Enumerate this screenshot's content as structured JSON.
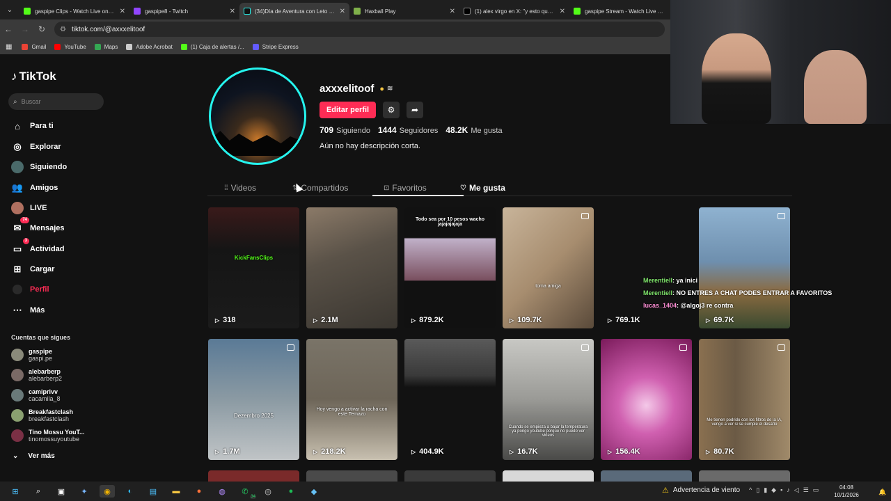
{
  "browser": {
    "tabs": [
      {
        "title": "gaspipe Clips - Watch Live on Kick",
        "color": "#53fc18",
        "active": false
      },
      {
        "title": "gaspipe8 - Twitch",
        "color": "#9146ff",
        "active": false
      },
      {
        "title": "(34)Día de Aventura con Leto e...",
        "color": "#ffffff",
        "active": true
      },
      {
        "title": "Haxball Play",
        "color": "#7fb04a",
        "active": false
      },
      {
        "title": "(1) alex virgo en X: \"y esto que...",
        "color": "#ffffff",
        "active": false
      },
      {
        "title": "gaspipe Stream - Watch Live on Kick",
        "color": "#53fc18",
        "active": false
      }
    ],
    "url": "tiktok.com/@axxxelitoof",
    "bookmarks": [
      {
        "label": "Gmail",
        "color": "#ea4335"
      },
      {
        "label": "YouTube",
        "color": "#ff0000"
      },
      {
        "label": "Maps",
        "color": "#34a853"
      },
      {
        "label": "Adobe Acrobat",
        "color": "#cccccc"
      },
      {
        "label": "(1) Caja de alertas /...",
        "color": "#53fc18"
      },
      {
        "label": "Stripe Express",
        "color": "#635bff"
      }
    ]
  },
  "sidebar": {
    "logo": "TikTok",
    "search_placeholder": "Buscar",
    "items": [
      {
        "label": "Para ti",
        "icon": "home-icon"
      },
      {
        "label": "Explorar",
        "icon": "compass-icon"
      },
      {
        "label": "Siguiendo",
        "icon": "following-avatar-icon"
      },
      {
        "label": "Amigos",
        "icon": "friends-icon"
      },
      {
        "label": "LIVE",
        "icon": "live-icon"
      },
      {
        "label": "Mensajes",
        "icon": "messages-icon",
        "badge": "74"
      },
      {
        "label": "Actividad",
        "icon": "activity-icon",
        "badge": "3"
      },
      {
        "label": "Cargar",
        "icon": "upload-icon"
      },
      {
        "label": "Perfil",
        "icon": "profile-icon"
      },
      {
        "label": "Más",
        "icon": "more-icon"
      }
    ],
    "following_title": "Cuentas que sigues",
    "following": [
      {
        "name": "gaspipe",
        "handle": "gaspi.pe"
      },
      {
        "name": "alebarberp",
        "handle": "alebarberp2"
      },
      {
        "name": "camiprivv",
        "handle": "cacamila_8"
      },
      {
        "name": "Breakfastclash",
        "handle": "breakfastclash"
      },
      {
        "name": "Tino Mossu YouT...",
        "handle": "tinomossuyoutube"
      }
    ],
    "see_more": "Ver más"
  },
  "profile": {
    "username": "axxxelitoof",
    "edit_label": "Editar perfil",
    "stats": [
      {
        "value": "709",
        "label": "Siguiendo"
      },
      {
        "value": "1444",
        "label": "Seguidores"
      },
      {
        "value": "48.2K",
        "label": "Me gusta"
      }
    ],
    "bio": "Aún no hay descripción corta.",
    "tabs": [
      "Videos",
      "Compartidos",
      "Favoritos",
      "Me gusta"
    ]
  },
  "videos": [
    {
      "views": "318",
      "caption": "KickFansClips",
      "bg": "#1b1b1b",
      "photo": false
    },
    {
      "views": "2.1M",
      "caption": "",
      "bg": "#5a5248",
      "photo": false
    },
    {
      "views": "879.2K",
      "caption": "Todo sea por 10 pesos wacho jajajajajaja",
      "bg": "#d0d0d0",
      "photo": false
    },
    {
      "views": "109.7K",
      "caption": "toma amiga",
      "bg": "#a78d6f",
      "photo": true
    },
    {
      "views": "769.1K",
      "caption": "",
      "bg": "#121212",
      "photo": false
    },
    {
      "views": "69.7K",
      "caption": "",
      "bg": "#6e8fae",
      "photo": true
    },
    {
      "views": "1.7M",
      "caption": "Dezembro 2025",
      "bg": "#8b9aa3",
      "photo": true
    },
    {
      "views": "218.2K",
      "caption": "Hoy vengo a activar la racha con este Temazo",
      "bg": "#6d6558",
      "photo": false
    },
    {
      "views": "404.9K",
      "caption": "",
      "bg": "#3a3a3a",
      "photo": false
    },
    {
      "views": "16.7K",
      "caption": "Cuando se empieza a bajar la temperatura ya pongo youtube porque no puedo ver videos",
      "bg": "#9a9a96",
      "photo": true
    },
    {
      "views": "156.4K",
      "caption": "",
      "bg": "#b4418a",
      "photo": true
    },
    {
      "views": "80.7K",
      "caption": "Me tienen podrido con los filtros de la IA, vengo a ver si se cumple el desafío",
      "bg": "#6b5a45",
      "photo": true
    }
  ],
  "chat": [
    {
      "user": "Merentiell",
      "text": ": ya inici"
    },
    {
      "user": "Merentiell",
      "text": ": NO ENTRES A CHAT PODES ENTRAR A FAVORITOS"
    },
    {
      "user": "lucas_1404",
      "text": ": @algoj3 re contra"
    }
  ],
  "taskbar": {
    "warning": "Advertencia de viento",
    "time": "04:08",
    "date": "10/1/2026",
    "badge": "34"
  },
  "colors": {
    "accent": "#fe2c55",
    "ring": "#25f4ee"
  }
}
